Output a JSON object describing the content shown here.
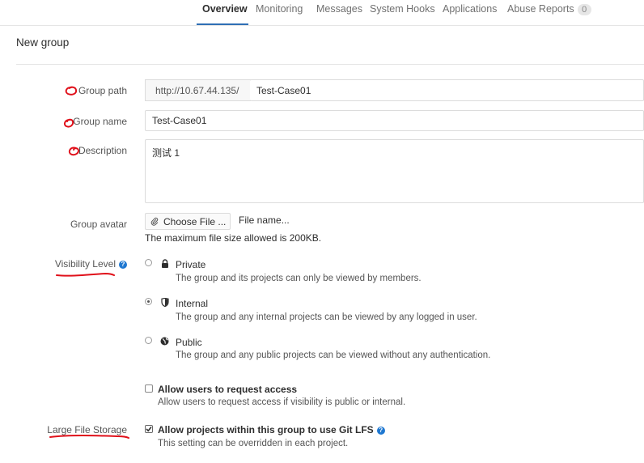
{
  "nav": {
    "tabs": [
      {
        "label": "Overview",
        "active": true
      },
      {
        "label": "Monitoring",
        "active": false
      },
      {
        "label": "Messages",
        "active": false
      },
      {
        "label": "System Hooks",
        "active": false
      },
      {
        "label": "Applications",
        "active": false
      },
      {
        "label": "Abuse Reports",
        "active": false
      }
    ],
    "abuse_count": "0"
  },
  "page_title": "New group",
  "form": {
    "group_path": {
      "label": "Group path",
      "prefix": "http://10.67.44.135/",
      "value": "Test-Case01"
    },
    "group_name": {
      "label": "Group name",
      "value": "Test-Case01"
    },
    "description": {
      "label": "Description",
      "value": "测试 1"
    },
    "avatar": {
      "label": "Group avatar",
      "button_label": "Choose File ...",
      "file_name": "File name...",
      "help": "The maximum file size allowed is 200KB."
    },
    "visibility": {
      "label": "Visibility Level",
      "selected": "Internal",
      "options": [
        {
          "label": "Private",
          "icon": "lock-icon",
          "description": "The group and its projects can only be viewed by members."
        },
        {
          "label": "Internal",
          "icon": "shield-icon",
          "description": "The group and any internal projects can be viewed by any logged in user."
        },
        {
          "label": "Public",
          "icon": "globe-icon",
          "description": "The group and any public projects can be viewed without any authentication."
        }
      ]
    },
    "request_access": {
      "label": "Allow users to request access",
      "checked": false,
      "help": "Allow users to request access if visibility is public or internal."
    },
    "lfs": {
      "section_label": "Large File Storage",
      "label": "Allow projects within this group to use Git LFS",
      "checked": true,
      "help": "This setting can be overridden in each project."
    }
  },
  "colors": {
    "accent": "#2f6fb5",
    "annotation": "#e0101a",
    "help_icon": "#1f78d1"
  }
}
